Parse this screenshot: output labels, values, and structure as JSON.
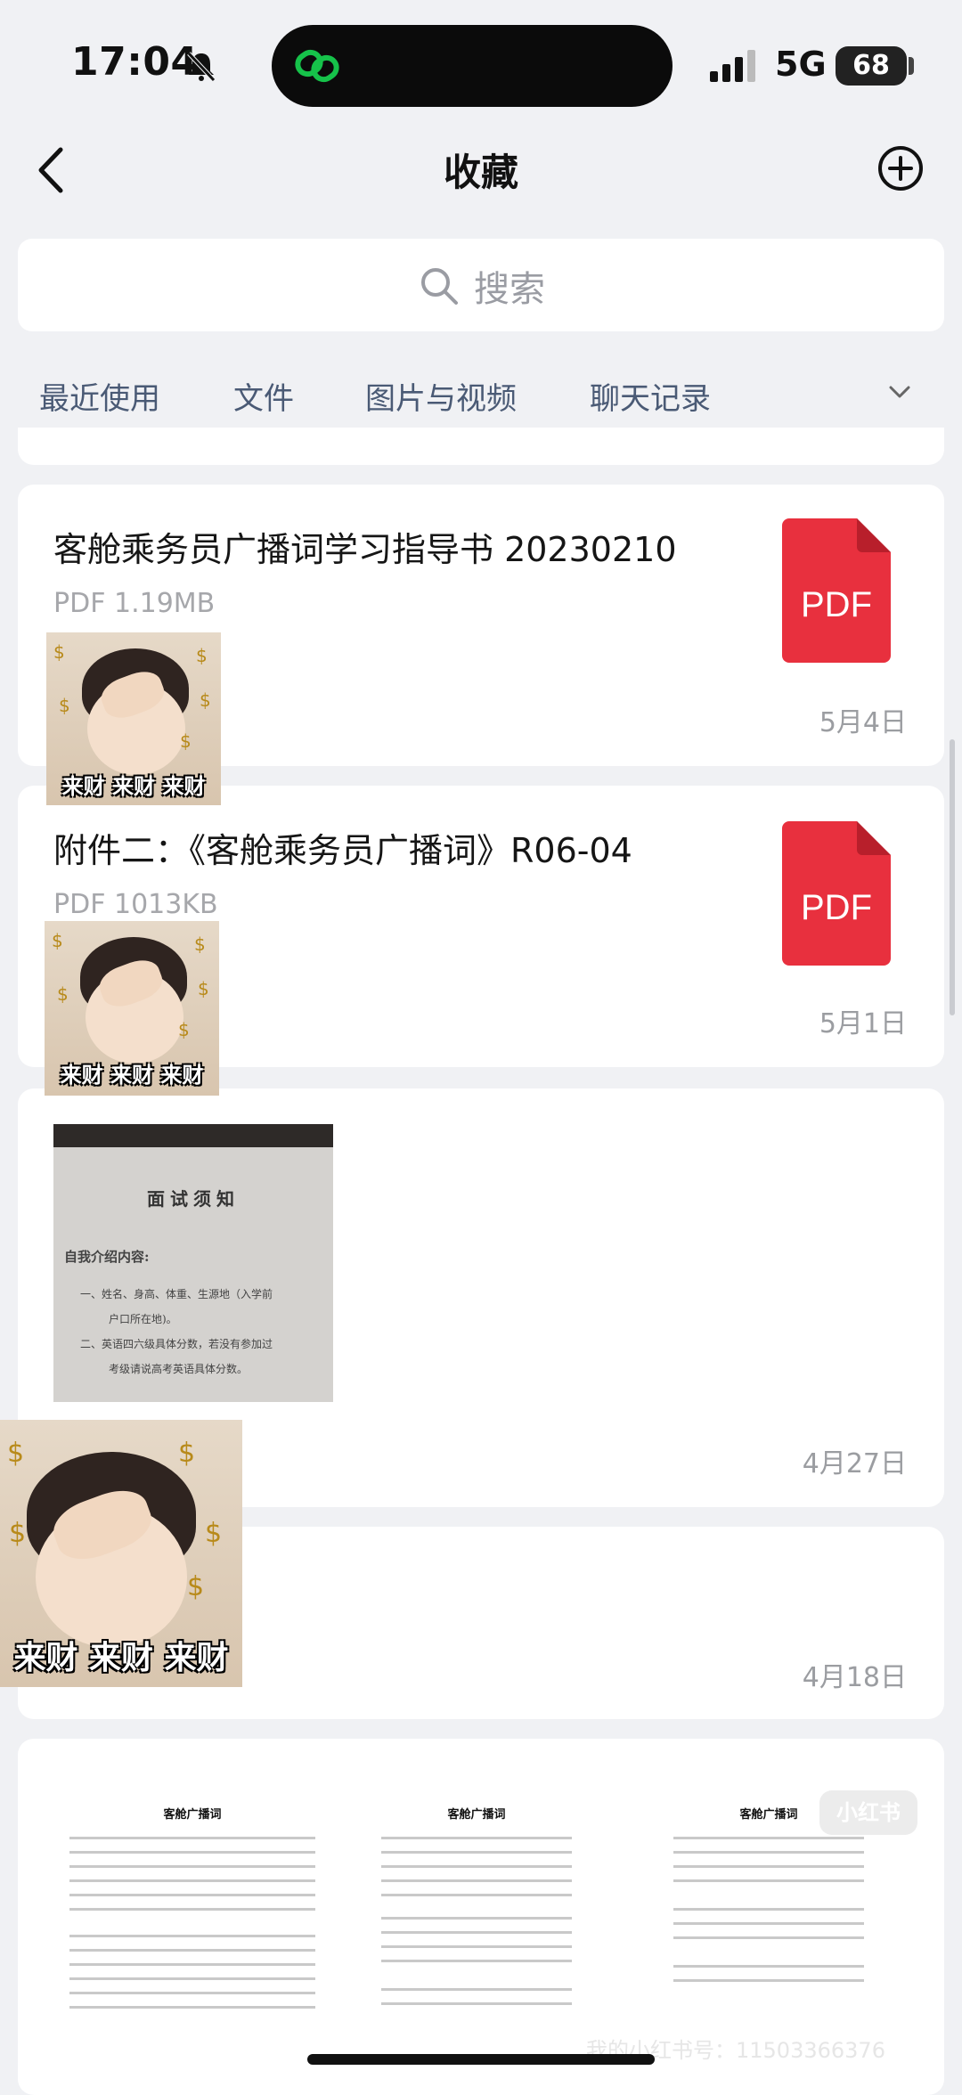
{
  "status_bar": {
    "time": "17:04",
    "network": "5G",
    "battery": "68"
  },
  "nav": {
    "title": "收藏"
  },
  "search": {
    "placeholder": "搜索"
  },
  "tabs": [
    {
      "label": "最近使用"
    },
    {
      "label": "文件"
    },
    {
      "label": "图片与视频"
    },
    {
      "label": "聊天记录"
    }
  ],
  "items": [
    {
      "title": "客舱乘务员广播词学习指导书 20230210",
      "meta": "PDF 1.19MB",
      "date": "5月4日",
      "icon_label": "PDF"
    },
    {
      "title": "附件二：《客舱乘务员广播词》R06-04",
      "meta": "PDF 1013KB",
      "date": "5月1日",
      "icon_label": "PDF"
    },
    {
      "date": "4月27日",
      "doc_title": "面试须知",
      "doc_lines": [
        "自我介绍内容:",
        "一、姓名、身高、体重、生源地（入学前",
        "户口所在地)。",
        "二、英语四六级具体分数，若没有参加过",
        "考级请说高考英语具体分数。"
      ]
    },
    {
      "date": "4月18日"
    }
  ],
  "sticker": {
    "caption": "来财 来财 来财"
  },
  "pages": [
    "客舱广播词",
    "客舱广播词",
    "客舱广播词"
  ],
  "watermark": {
    "logo": "小红书",
    "text": "我的小红书号：11503366376"
  },
  "colors": {
    "pdf_red": "#e8303e",
    "tab_text": "#4a5a75",
    "accent_green": "#16c24a"
  }
}
